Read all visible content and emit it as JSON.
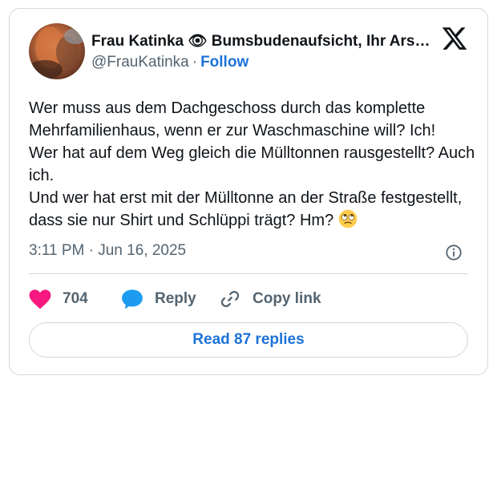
{
  "author": {
    "display_name": "Frau Katinka 👁 Bumsbudenaufsicht, Ihr Ars…",
    "handle": "@FrauKatinka",
    "separator": "·",
    "follow_label": "Follow"
  },
  "tweet": {
    "lines": [
      "Wer muss aus dem Dachgeschoss durch das komplette Mehrfamilienhaus, wenn er zur Waschmaschine will? Ich!",
      "Wer hat auf dem Weg gleich die Mülltonnen rausgestellt? Auch ich.",
      "Und wer hat erst mit der Mülltonne an der Straße festgestellt, dass sie nur Shirt und Schlüppi trägt? Hm?"
    ],
    "emoji": "rolling-eyes-emoji",
    "timestamp": "3:11 PM · Jun 16, 2025"
  },
  "actions": {
    "like_count": "704",
    "reply_label": "Reply",
    "copy_link_label": "Copy link"
  },
  "read_replies_label": "Read 87 replies",
  "colors": {
    "like": "#f91880",
    "reply": "#1d9bf0",
    "link": "#1d72d8",
    "secondary_text": "#536471",
    "border": "#cfd9de"
  },
  "icons": [
    "x-logo-icon",
    "info-icon",
    "heart-icon",
    "reply-bubble-icon",
    "link-icon"
  ]
}
